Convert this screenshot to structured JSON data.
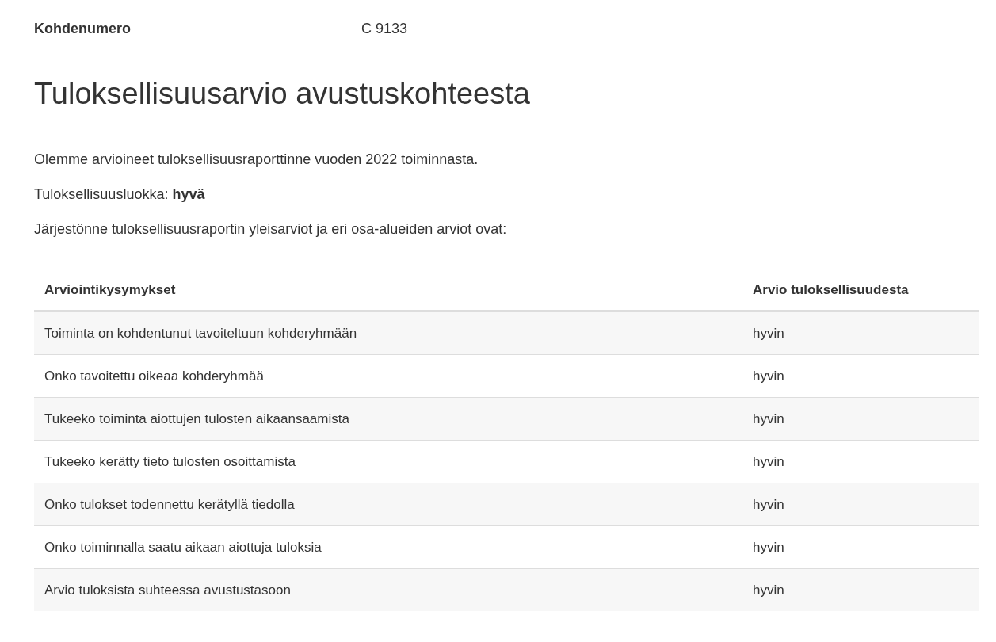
{
  "meta": {
    "label": "Kohdenumero",
    "value": "C 9133"
  },
  "heading": "Tuloksellisuusarvio avustuskohteesta",
  "paragraphs": [
    "Olemme arvioineet tuloksellisuusraporttinne vuoden 2022 toiminnasta.",
    "Tuloksellisuusluokka: **hyvä**",
    "Järjestönne tuloksellisuusraportin yleisarviot ja eri osa-alueiden arviot ovat:"
  ],
  "table": {
    "columns": [
      "Arviointikysymykset",
      "Arvio tuloksellisuudesta"
    ],
    "rows": [
      [
        "Toiminta on kohdentunut tavoiteltuun kohderyhmään",
        "hyvin"
      ],
      [
        "Onko tavoitettu oikeaa kohderyhmää",
        "hyvin"
      ],
      [
        "Tukeeko toiminta aiottujen tulosten aikaansaamista",
        "hyvin"
      ],
      [
        "Tukeeko kerätty tieto tulosten osoittamista",
        "hyvin"
      ],
      [
        "Onko tulokset todennettu kerätyllä tiedolla",
        "hyvin"
      ],
      [
        "Onko toiminnalla saatu aikaan aiottuja tuloksia",
        "hyvin"
      ],
      [
        "Arvio tuloksista suhteessa avustustasoon",
        "hyvin"
      ]
    ]
  }
}
